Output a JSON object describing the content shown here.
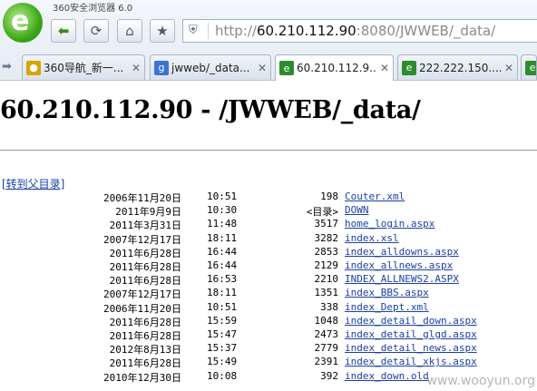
{
  "browser": {
    "app_title": "360安全浏览器 6.0",
    "url_scheme": "http://",
    "url_host": "60.210.112.90",
    "url_rest": ":8080/JWWEB/_data/"
  },
  "tabs": [
    {
      "label": "360导航_新一...",
      "icon": "360-icon",
      "color": "#d9a400"
    },
    {
      "label": "jwweb/_data...",
      "icon": "google-icon",
      "color": "#3b73d8"
    },
    {
      "label": "60.210.112.9...",
      "icon": "page-icon",
      "color": "#2e8b2e",
      "active": true
    },
    {
      "label": "222.222.150....",
      "icon": "page-icon",
      "color": "#2e8b2e"
    },
    {
      "label": "",
      "icon": "page-icon",
      "color": "#2e8b2e"
    }
  ],
  "page": {
    "title": "60.210.112.90 - /JWWEB/_data/",
    "parent_link": "[转到父目录]",
    "rows": [
      {
        "date": "2006年11月20日",
        "time": "10:51",
        "size": "198",
        "name": "Couter.xml"
      },
      {
        "date": "2011年9月9日",
        "time": "10:30",
        "size": "<目录>",
        "name": "DOWN"
      },
      {
        "date": "2011年3月31日",
        "time": "11:48",
        "size": "3517",
        "name": "home_login.aspx"
      },
      {
        "date": "2007年12月17日",
        "time": "18:11",
        "size": "3282",
        "name": "index.xsl"
      },
      {
        "date": "2011年6月28日",
        "time": "16:44",
        "size": "2853",
        "name": "index_alldowns.aspx"
      },
      {
        "date": "2011年6月28日",
        "time": "16:44",
        "size": "2129",
        "name": "index_allnews.aspx"
      },
      {
        "date": "2011年6月28日",
        "time": "16:53",
        "size": "2210",
        "name": "INDEX_ALLNEWS2.ASPX"
      },
      {
        "date": "2007年12月17日",
        "time": "18:11",
        "size": "1351",
        "name": "index_BBS.aspx"
      },
      {
        "date": "2006年11月20日",
        "time": "10:51",
        "size": "338",
        "name": "index_Dept.xml"
      },
      {
        "date": "2011年6月28日",
        "time": "15:59",
        "size": "1048",
        "name": "index_detail_down.aspx"
      },
      {
        "date": "2011年6月28日",
        "time": "15:47",
        "size": "2473",
        "name": "index_detail_glgd.aspx"
      },
      {
        "date": "2012年8月13日",
        "time": "15:37",
        "size": "2779",
        "name": "index_detail_news.aspx"
      },
      {
        "date": "2011年6月28日",
        "time": "15:49",
        "size": "2391",
        "name": "index_detail_xkjs.aspx"
      },
      {
        "date": "2010年12月30日",
        "time": "10:08",
        "size": "392",
        "name": "index_down.old"
      }
    ]
  },
  "watermark": "www.wooyun.org"
}
